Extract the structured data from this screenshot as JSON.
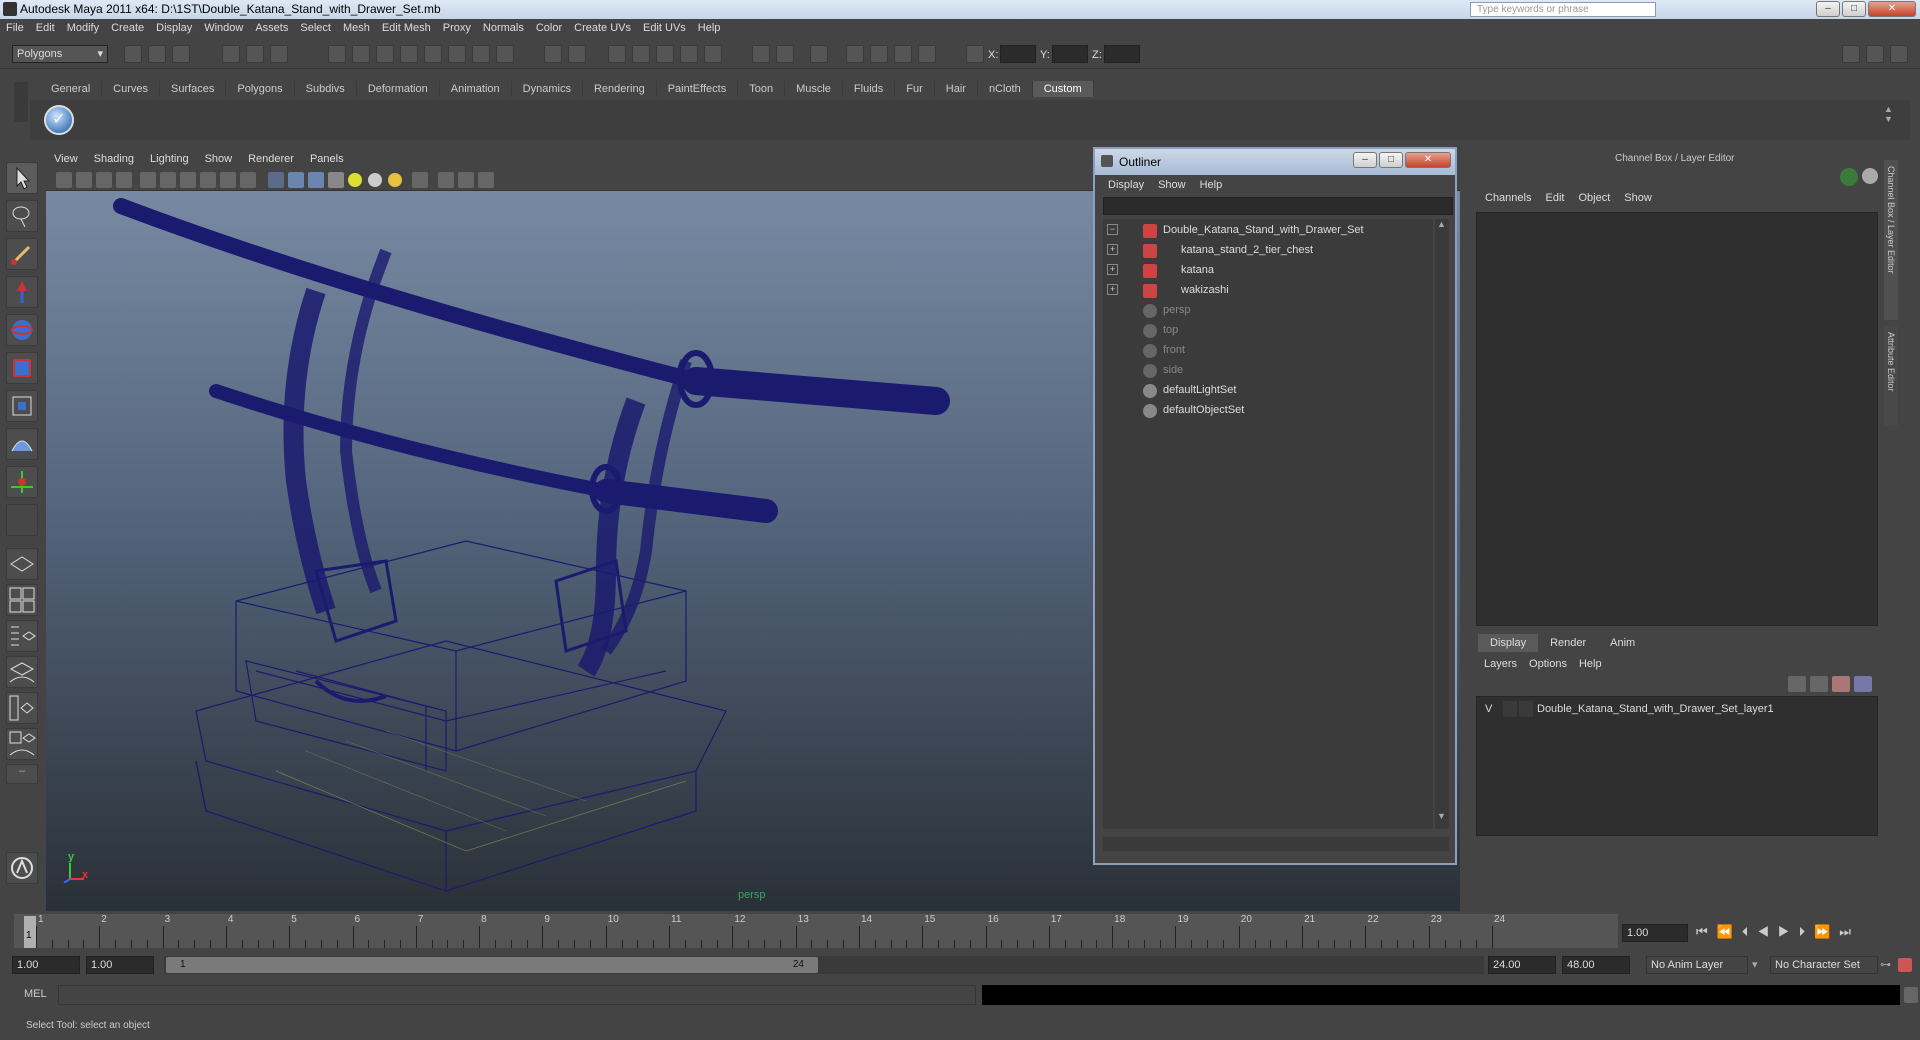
{
  "window": {
    "title": "Autodesk Maya 2011 x64: D:\\1ST\\Double_Katana_Stand_with_Drawer_Set.mb",
    "search_placeholder": "Type keywords or phrase"
  },
  "menubar": [
    "File",
    "Edit",
    "Modify",
    "Create",
    "Display",
    "Window",
    "Assets",
    "Select",
    "Mesh",
    "Edit Mesh",
    "Proxy",
    "Normals",
    "Color",
    "Create UVs",
    "Edit UVs",
    "Help"
  ],
  "statusline": {
    "mode": "Polygons",
    "x_label": "X:",
    "y_label": "Y:",
    "z_label": "Z:"
  },
  "shelf_tabs": [
    "General",
    "Curves",
    "Surfaces",
    "Polygons",
    "Subdivs",
    "Deformation",
    "Animation",
    "Dynamics",
    "Rendering",
    "PaintEffects",
    "Toon",
    "Muscle",
    "Fluids",
    "Fur",
    "Hair",
    "nCloth",
    "Custom"
  ],
  "shelf_active": "Custom",
  "viewport": {
    "menu": [
      "View",
      "Shading",
      "Lighting",
      "Show",
      "Renderer",
      "Panels"
    ],
    "camera_label": "persp",
    "axis_y": "y",
    "axis_x": "x",
    "wire_color": "#1a1a6e"
  },
  "outliner": {
    "title": "Outliner",
    "menu": [
      "Display",
      "Show",
      "Help"
    ],
    "items": [
      {
        "label": "Double_Katana_Stand_with_Drawer_Set",
        "expander": "−",
        "type": "mesh"
      },
      {
        "label": "katana_stand_2_tier_chest",
        "expander": "+",
        "type": "mesh"
      },
      {
        "label": "katana",
        "expander": "+",
        "type": "mesh"
      },
      {
        "label": "wakizashi",
        "expander": "+",
        "type": "mesh"
      },
      {
        "label": "persp",
        "expander": "",
        "type": "camera"
      },
      {
        "label": "top",
        "expander": "",
        "type": "camera"
      },
      {
        "label": "front",
        "expander": "",
        "type": "camera"
      },
      {
        "label": "side",
        "expander": "",
        "type": "camera"
      },
      {
        "label": "defaultLightSet",
        "expander": "",
        "type": "set"
      },
      {
        "label": "defaultObjectSet",
        "expander": "",
        "type": "set"
      }
    ]
  },
  "channelbox": {
    "title": "Channel Box / Layer Editor",
    "menu": [
      "Channels",
      "Edit",
      "Object",
      "Show"
    ],
    "layer_tabs": [
      "Display",
      "Render",
      "Anim"
    ],
    "layer_menu": [
      "Layers",
      "Options",
      "Help"
    ],
    "layer_v": "V",
    "layer_name": "Double_Katana_Stand_with_Drawer_Set_layer1",
    "side_tab_1": "Channel Box / Layer Editor",
    "side_tab_2": "Attribute Editor"
  },
  "timeline": {
    "frames": [
      "1",
      "2",
      "3",
      "4",
      "5",
      "6",
      "7",
      "8",
      "9",
      "10",
      "11",
      "12",
      "13",
      "14",
      "15",
      "16",
      "17",
      "18",
      "19",
      "20",
      "21",
      "22",
      "23",
      "24"
    ],
    "current_frame": "1.00",
    "current_marker": "1"
  },
  "rangebar": {
    "start": "1.00",
    "start2": "1.00",
    "range_start": "1",
    "range_end": "24",
    "end": "24.00",
    "end2": "48.00",
    "anim_layer": "No Anim Layer",
    "char_set": "No Character Set"
  },
  "cmdline": {
    "label": "MEL"
  },
  "helpline": {
    "text": "Select Tool: select an object"
  }
}
